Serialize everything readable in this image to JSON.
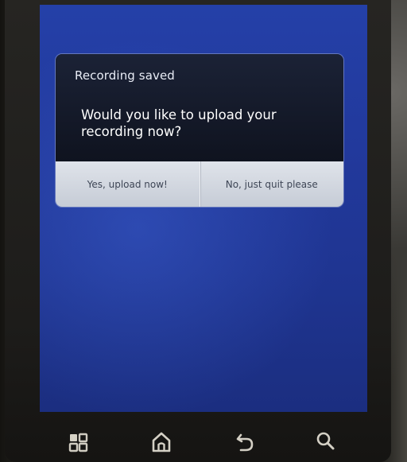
{
  "dialog": {
    "title": "Recording saved",
    "message": "Would you like to upload your recording now?",
    "positive_button": "Yes, upload now!",
    "negative_button": "No, just quit please"
  },
  "navbar": {
    "icons": [
      "menu-grid-icon",
      "home-icon",
      "back-icon",
      "search-icon"
    ]
  },
  "colors": {
    "screen_blue": "#22399c",
    "dialog_dark": "#0f131f",
    "dialog_button_bg": "#d4d9e1",
    "button_text": "#3e4656"
  }
}
